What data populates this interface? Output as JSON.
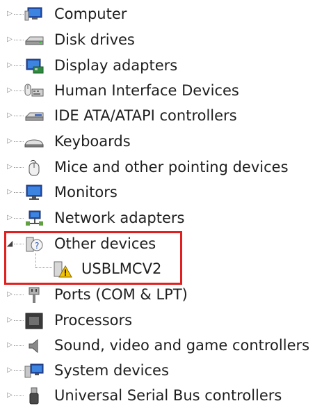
{
  "tree": {
    "items": [
      {
        "label": "Computer",
        "icon": "computer-icon"
      },
      {
        "label": "Disk drives",
        "icon": "disk-drive-icon"
      },
      {
        "label": "Display adapters",
        "icon": "display-adapter-icon"
      },
      {
        "label": "Human Interface Devices",
        "icon": "hid-icon"
      },
      {
        "label": "IDE ATA/ATAPI controllers",
        "icon": "ide-controller-icon"
      },
      {
        "label": "Keyboards",
        "icon": "keyboard-icon"
      },
      {
        "label": "Mice and other pointing devices",
        "icon": "mouse-icon"
      },
      {
        "label": "Monitors",
        "icon": "monitor-icon"
      },
      {
        "label": "Network adapters",
        "icon": "network-adapter-icon"
      },
      {
        "label": "Other devices",
        "icon": "unknown-device-icon",
        "expanded": true,
        "children": [
          {
            "label": "USBLMCV2",
            "icon": "warning-device-icon"
          }
        ]
      },
      {
        "label": "Ports (COM & LPT)",
        "icon": "port-icon"
      },
      {
        "label": "Processors",
        "icon": "processor-icon"
      },
      {
        "label": "Sound, video and game controllers",
        "icon": "speaker-icon"
      },
      {
        "label": "System devices",
        "icon": "system-device-icon"
      },
      {
        "label": "Universal Serial Bus controllers",
        "icon": "usb-icon"
      }
    ]
  },
  "colors": {
    "highlight": "#e02020",
    "text": "#1e1e1e",
    "warning": "#f2c200"
  }
}
